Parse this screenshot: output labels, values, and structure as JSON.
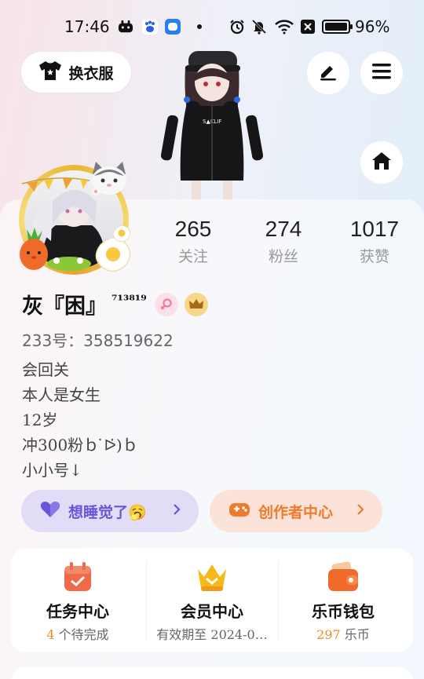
{
  "status_bar": {
    "time": "17:46",
    "battery": "96%"
  },
  "header": {
    "dress_button_label": "换衣服"
  },
  "profile": {
    "name": "灰『困』",
    "name_superscript": "⁷¹³⁸¹⁹",
    "uid": "233号：358519622",
    "bio": [
      "会回关",
      "本人是女生",
      "12岁",
      "冲300粉ｂ ̇ᐅ̇)ｂ",
      "小小号↓"
    ]
  },
  "stats": [
    {
      "num": "265",
      "label": "关注"
    },
    {
      "num": "274",
      "label": "粉丝"
    },
    {
      "num": "1017",
      "label": "获赞"
    }
  ],
  "pills": {
    "mood": "想睡觉了🥱",
    "creator": "创作者中心"
  },
  "services": [
    {
      "title": "任务中心",
      "count": "4",
      "sub_rest": " 个待完成"
    },
    {
      "title": "会员中心",
      "sub": "有效期至 2024-0…"
    },
    {
      "title": "乐币钱包",
      "count": "297",
      "sub_rest": " 乐币"
    }
  ],
  "colors": {
    "accent_orange": "#f08a2a",
    "mood_pill_bg": "#e2dcf7",
    "mood_pill_text": "#6a54d8",
    "creator_pill_bg": "#fbe3d9",
    "creator_pill_text": "#f07a2a"
  }
}
